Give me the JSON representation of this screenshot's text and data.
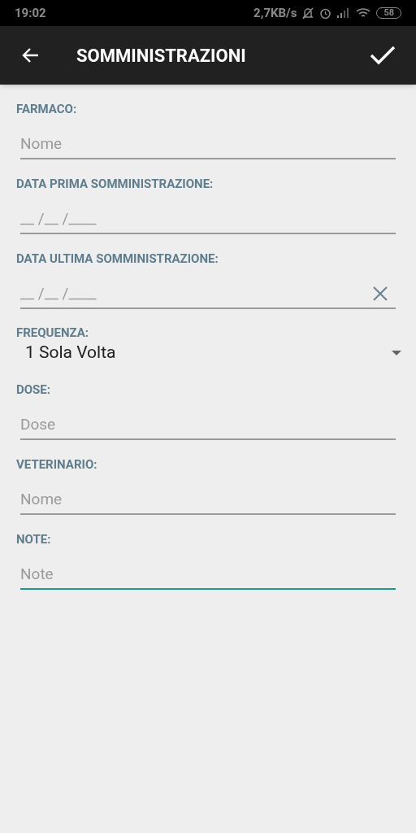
{
  "status_bar": {
    "time": "19:02",
    "speed": "2,7KB/s",
    "battery": "58"
  },
  "app_bar": {
    "title": "SOMMINISTRAZIONI"
  },
  "fields": [
    {
      "kind": "text",
      "label": "FARMACO:",
      "placeholder": "Nome",
      "focused": false
    },
    {
      "kind": "date",
      "label": "DATA PRIMA SOMMINISTRAZIONE:",
      "placeholder": "__ /__ /____",
      "clearable": false,
      "focused": false
    },
    {
      "kind": "date",
      "label": "DATA ULTIMA SOMMINISTRAZIONE:",
      "placeholder": "__ /__ /____",
      "clearable": true,
      "focused": false
    },
    {
      "kind": "select",
      "label": "FREQUENZA:",
      "value": "1 Sola Volta"
    },
    {
      "kind": "text",
      "label": "DOSE:",
      "placeholder": "Dose",
      "focused": false
    },
    {
      "kind": "text",
      "label": "VETERINARIO:",
      "placeholder": "Nome",
      "focused": false
    },
    {
      "kind": "text",
      "label": "NOTE:",
      "placeholder": "Note",
      "focused": true
    }
  ]
}
